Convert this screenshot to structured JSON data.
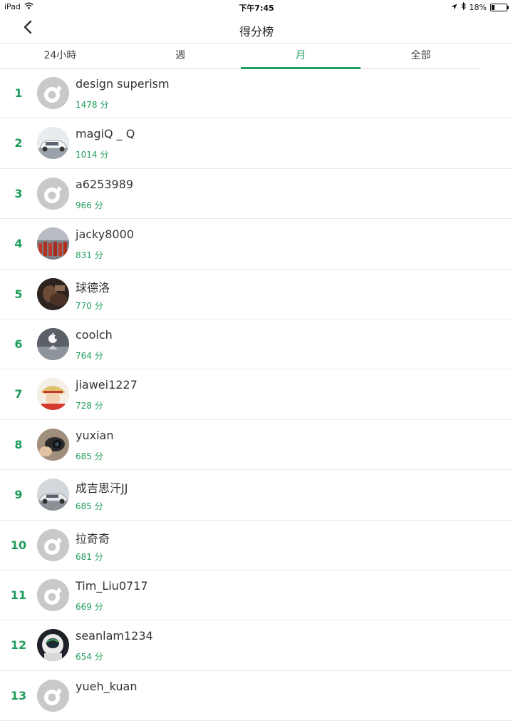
{
  "status_bar": {
    "device": "iPad",
    "time": "下午7:45",
    "battery": "18%",
    "battery_level": 0.18,
    "icons": [
      "wifi-icon",
      "location-arrow-icon",
      "bluetooth-icon",
      "battery-icon"
    ]
  },
  "header": {
    "title": "得分榜",
    "back_icon": "chevron-left-icon"
  },
  "tabs": [
    {
      "label": "24小時",
      "active": false
    },
    {
      "label": "週",
      "active": false
    },
    {
      "label": "月",
      "active": true
    },
    {
      "label": "全部",
      "active": false
    }
  ],
  "colors": {
    "accent": "#1f9d5c",
    "text": "#333333",
    "divider": "#e8e8e8",
    "default_avatar": "#c9c9c9"
  },
  "leaderboard": [
    {
      "rank": "1",
      "name": "design superism",
      "score": "1478 分",
      "avatar": "default"
    },
    {
      "rank": "2",
      "name": "magiQ _ Q",
      "score": "1014 分",
      "avatar": "car-white"
    },
    {
      "rank": "3",
      "name": "a6253989",
      "score": "966 分",
      "avatar": "default"
    },
    {
      "rank": "4",
      "name": "jacky8000",
      "score": "831 分",
      "avatar": "crowd"
    },
    {
      "rank": "5",
      "name": "球德洛",
      "score": "770 分",
      "avatar": "person-dark"
    },
    {
      "rank": "6",
      "name": "coolch",
      "score": "764 分",
      "avatar": "apple-logo"
    },
    {
      "rank": "7",
      "name": "jiawei1227",
      "score": "728 分",
      "avatar": "anime-character"
    },
    {
      "rank": "8",
      "name": "yuxian",
      "score": "685 分",
      "avatar": "camera-hand"
    },
    {
      "rank": "9",
      "name": "成吉思汗JJ",
      "score": "685 分",
      "avatar": "car-silver"
    },
    {
      "rank": "10",
      "name": "拉奇奇",
      "score": "681 分",
      "avatar": "default"
    },
    {
      "rank": "11",
      "name": "Tim_Liu0717",
      "score": "669 分",
      "avatar": "default"
    },
    {
      "rank": "12",
      "name": "seanlam1234",
      "score": "654 分",
      "avatar": "astronaut"
    },
    {
      "rank": "13",
      "name": "yueh_kuan",
      "score": "",
      "avatar": "default"
    }
  ]
}
